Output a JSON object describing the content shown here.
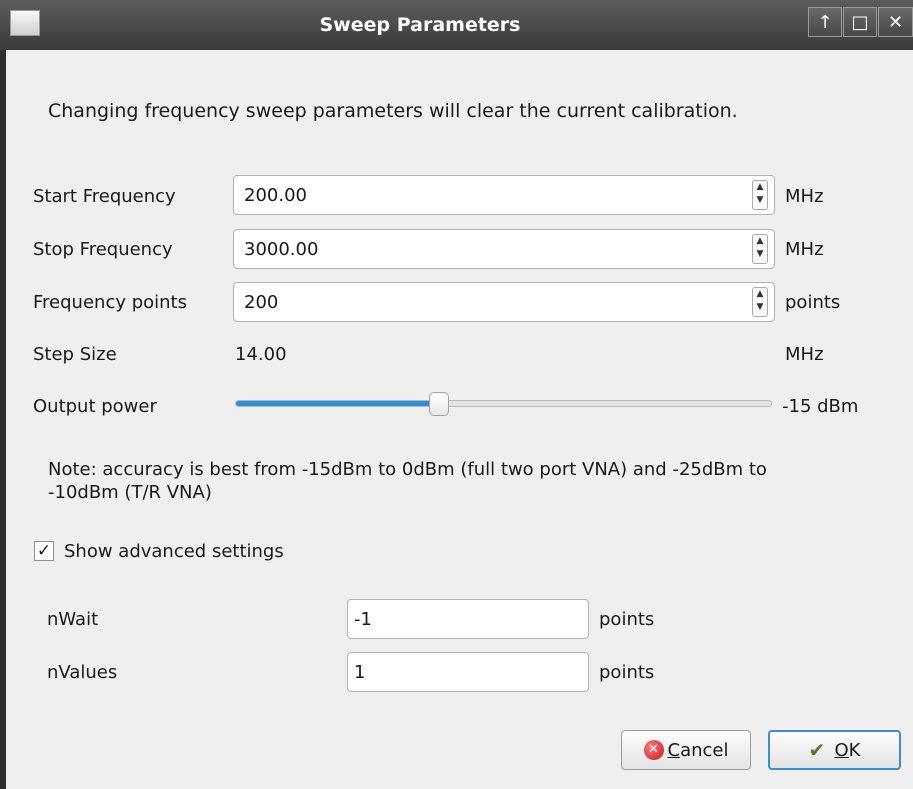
{
  "window": {
    "title": "Sweep Parameters"
  },
  "message": "Changing frequency sweep parameters will clear the current calibration.",
  "start_frequency": {
    "label": "Start Frequency",
    "value": "200.00",
    "unit": "MHz"
  },
  "stop_frequency": {
    "label": "Stop Frequency",
    "value": "3000.00",
    "unit": "MHz"
  },
  "frequency_points": {
    "label": "Frequency points",
    "value": "200",
    "unit": "points"
  },
  "step_size": {
    "label": "Step Size",
    "value": "14.00",
    "unit": "MHz"
  },
  "output_power": {
    "label": "Output power",
    "value_text": "-15 dBm",
    "slider_fraction": 0.38,
    "accent_color": "#2f8fd6"
  },
  "note": "Note: accuracy is best from -15dBm to 0dBm (full two port VNA) and -25dBm to -10dBm (T/R VNA)",
  "advanced": {
    "checkbox_label": "Show advanced settings",
    "checked": true,
    "check_glyph": "✓"
  },
  "nwait": {
    "label": "nWait",
    "value": "-1",
    "unit": "points"
  },
  "nvalues": {
    "label": "nValues",
    "value": "1",
    "unit": "points"
  },
  "buttons": {
    "cancel_mnemonic": "C",
    "cancel_rest": "ancel",
    "ok_mnemonic": "O",
    "ok_rest": "K"
  },
  "icons": {
    "app": "app-icon",
    "maximize": "↑",
    "restore": "□",
    "close": "✕",
    "spin_up": "▲",
    "spin_down": "▼",
    "cancel": "✕",
    "ok": "✔"
  }
}
